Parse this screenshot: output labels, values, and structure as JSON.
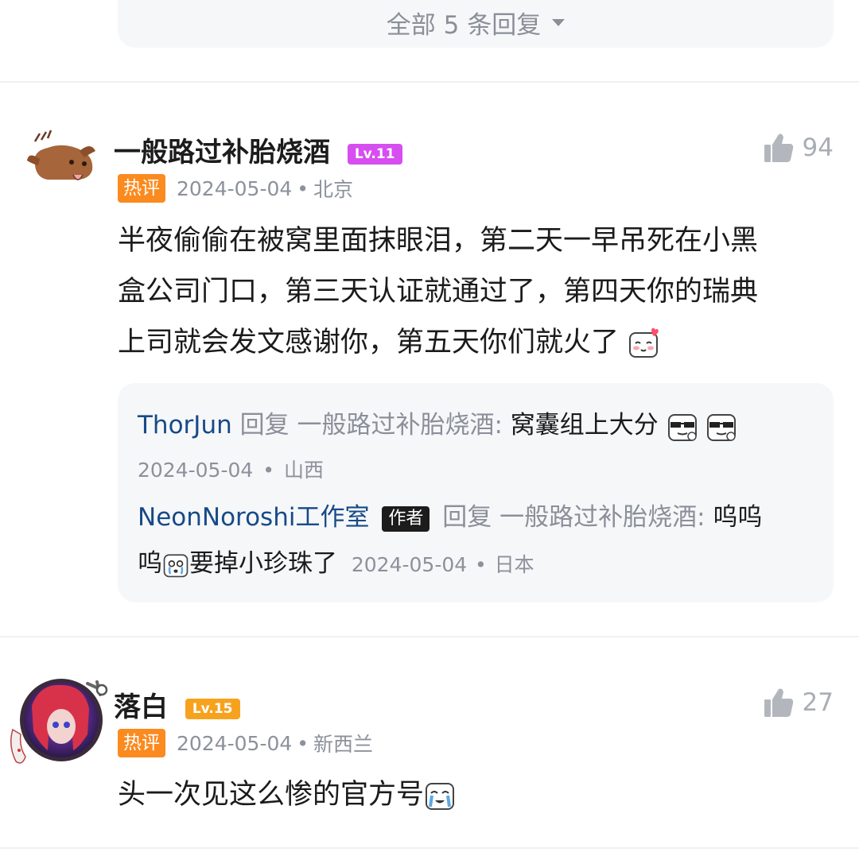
{
  "view_all_replies": "全部 5 条回复",
  "comments": [
    {
      "user": "一般路过补胎烧酒",
      "level": "Lv.11",
      "level_color": "#d64df0",
      "hot_tag": "热评",
      "date": "2024-05-04",
      "location": "北京",
      "likes": "94",
      "text_line1": "半夜偷偷在被窝里面抹眼泪，第二天一早吊死在小黑",
      "text_line2": "盒公司门口，第三天认证就通过了，第四天你的瑞典",
      "text_line3": "上司就会发文感谢你，第五天你们就火了",
      "replies": [
        {
          "user": "ThorJun",
          "reply_word": "回复",
          "target": "一般路过补胎烧酒:",
          "text": "窝囊组上大分",
          "date": "2024-05-04",
          "location": "山西"
        },
        {
          "user": "NeonNoroshi工作室",
          "author_tag": "作者",
          "reply_word": "回复",
          "target": "一般路过补胎烧酒:",
          "text_a": "呜呜",
          "text_b": "呜",
          "text_c": "要掉小珍珠了",
          "date": "2024-05-04",
          "location": "日本"
        }
      ]
    },
    {
      "user": "落白",
      "level": "Lv.15",
      "level_color": "#f7a21d",
      "hot_tag": "热评",
      "date": "2024-05-04",
      "location": "新西兰",
      "likes": "27",
      "text": "头一次见这么惨的官方号"
    }
  ],
  "icons": [
    "thumbs-up-icon",
    "chevron-down-icon",
    "blush-emoji",
    "sunglasses-emoji",
    "crying-emoji"
  ]
}
